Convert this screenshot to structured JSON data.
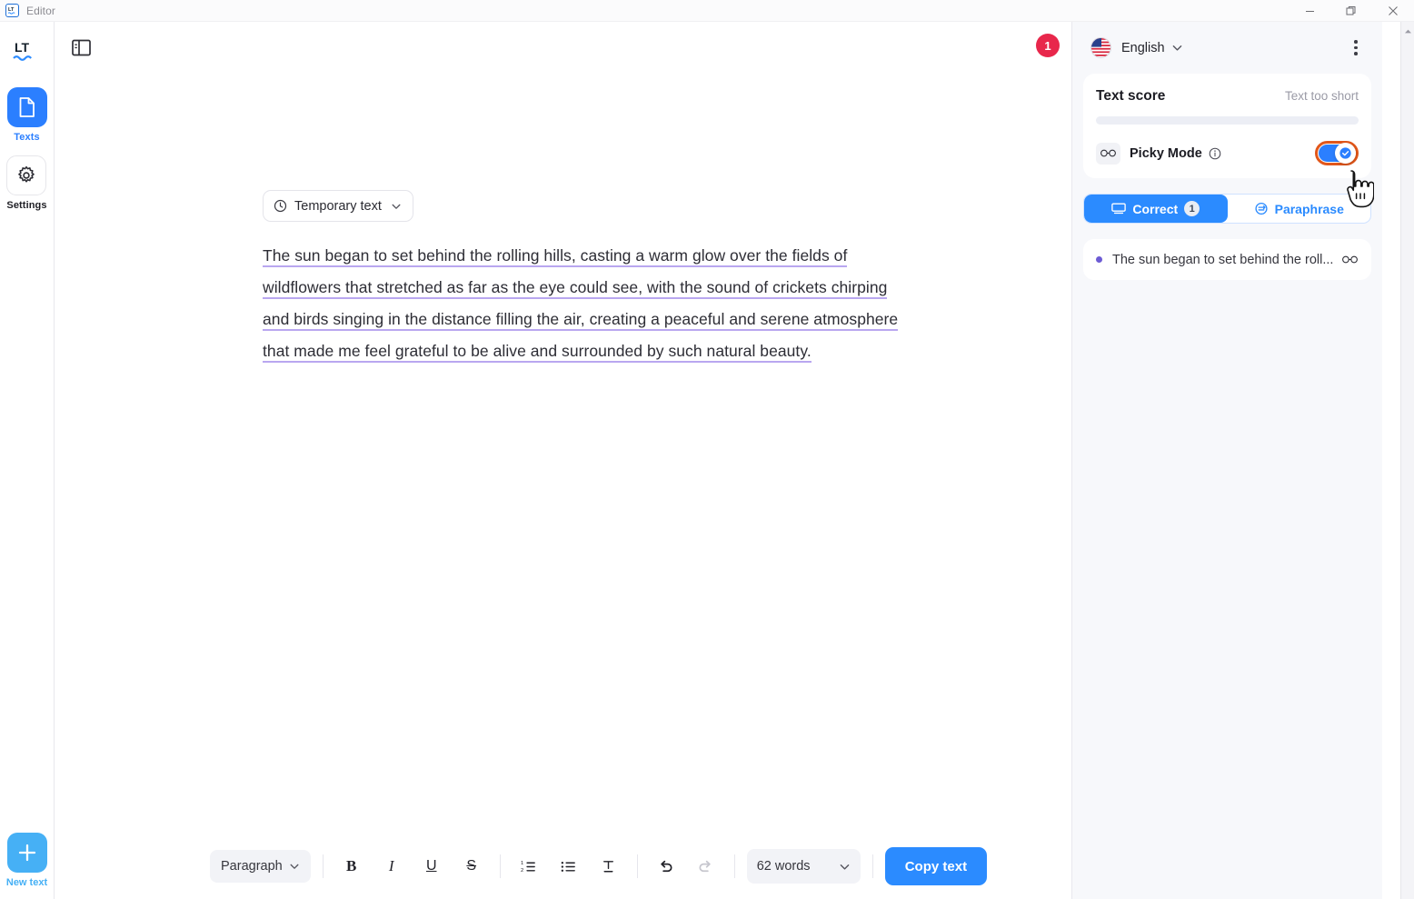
{
  "window": {
    "title": "Editor",
    "logo_icon": "lt-logo-icon",
    "minimize_icon": "minimize-icon",
    "maximize_icon": "maximize-icon",
    "close_icon": "close-icon"
  },
  "sidebar": {
    "logo_icon": "languagetool-logo-icon",
    "items": [
      {
        "label": "Texts",
        "icon": "document-icon",
        "active": true
      },
      {
        "label": "Settings",
        "icon": "gear-icon",
        "active": false
      }
    ],
    "new_text": {
      "label": "New text",
      "icon": "plus-icon"
    }
  },
  "editor": {
    "panel_toggle_icon": "sidebar-toggle-icon",
    "notification_badge": "1",
    "doc_pill": {
      "label": "Temporary text",
      "icon": "clock-icon",
      "chevron": "chevron-down-icon"
    },
    "document_text": "The sun began to set behind the rolling hills, casting a warm glow over the fields of wildflowers that stretched as far as the eye could see, with the sound of crickets chirping and birds singing in the distance filling the air, creating a peaceful and serene atmosphere that made me feel grateful to be alive and surrounded by such natural beauty."
  },
  "toolbar": {
    "paragraph_label": "Paragraph",
    "paragraph_chevron": "chevron-down-icon",
    "bold_label": "B",
    "italic_label": "I",
    "underline_label": "U",
    "strikethrough_label": "S",
    "numbered_list_icon": "numbered-list-icon",
    "bullet_list_icon": "bullet-list-icon",
    "clear_format_icon": "clear-formatting-icon",
    "undo_icon": "undo-icon",
    "redo_icon": "redo-icon",
    "word_count": "62 words",
    "word_count_chevron": "chevron-down-icon",
    "copy_label": "Copy text"
  },
  "right_panel": {
    "language": "English",
    "language_flag": "us-flag-icon",
    "language_chevron": "chevron-down-icon",
    "menu_icon": "kebab-menu-icon",
    "score": {
      "title": "Text score",
      "status": "Text too short",
      "progress_percent": 0
    },
    "picky_mode": {
      "label": "Picky Mode",
      "icon": "glasses-icon",
      "info_icon": "info-icon",
      "enabled": true,
      "highlight_color": "#e2571a"
    },
    "tabs": [
      {
        "label": "Correct",
        "icon": "correct-icon",
        "count": "1",
        "active": true
      },
      {
        "label": "Paraphrase",
        "icon": "paraphrase-icon",
        "count": "",
        "active": false
      }
    ],
    "suggestions": [
      {
        "text": "The sun began to set behind the roll...",
        "dot_color": "#6c5bd4",
        "icon": "glasses-icon"
      }
    ]
  },
  "scrollbar": {
    "arrow_icon": "scroll-up-arrow-icon"
  },
  "cursor": {
    "icon": "hand-pointer-cursor"
  }
}
